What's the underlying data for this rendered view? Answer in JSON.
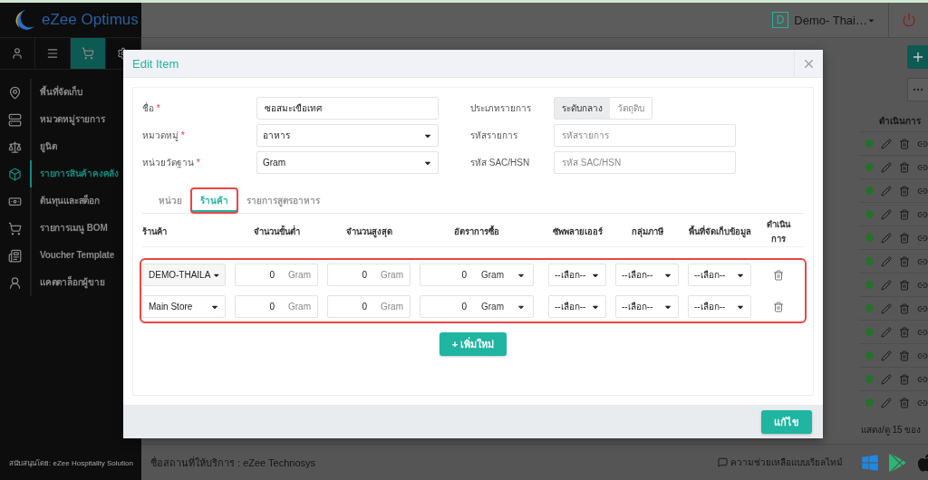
{
  "app": {
    "logo": "eZee Optimus",
    "property": {
      "badge": "D",
      "name": "Demo- Thai…"
    }
  },
  "sidebar": {
    "tabs": [
      {
        "selected": false
      },
      {
        "selected": false
      },
      {
        "selected": true
      },
      {
        "selected": false
      }
    ],
    "items": [
      {
        "label": "พื้นที่จัดเก็บ",
        "selected": false
      },
      {
        "label": "หมวดหมู่รายการ",
        "selected": false
      },
      {
        "label": "ยูนิต",
        "selected": false
      },
      {
        "label": "รายการสินค้าคงคลัง",
        "selected": true
      },
      {
        "label": "ต้นทุนและสต็อก",
        "selected": false
      },
      {
        "label": "รายการเมนู BOM",
        "selected": false
      },
      {
        "label": "Voucher Template",
        "selected": false
      },
      {
        "label": "แคตตาล็อกผู้ขาย",
        "selected": false
      }
    ],
    "footer": "สนับสนุนโดย: eZee Hospitality Solution"
  },
  "background_list": {
    "header": "ดำเนินการ",
    "rows": [
      {
        "color": "#26702c"
      },
      {
        "color": "#26702c"
      },
      {
        "color": "#26702c"
      },
      {
        "color": "#26702c"
      },
      {
        "color": "#26702c"
      },
      {
        "color": "#26702c"
      },
      {
        "color": "#26702c"
      },
      {
        "color": "#26702c"
      },
      {
        "color": "#26702c"
      },
      {
        "color": "#26702c"
      },
      {
        "color": "#26702c"
      },
      {
        "color": "#26702c"
      }
    ],
    "summary": "แสดง/ดู 15 ของ"
  },
  "footer": {
    "provider": "ชื่อสถานที่ให้บริการ : eZee Technosys",
    "help": "ความช่วยเหลือแบบเรียลไทม์"
  },
  "modal": {
    "title": "Edit Item",
    "fields_left": [
      {
        "label": "ชื่อ",
        "required_mark": "*",
        "kind": "text",
        "value": "ซอสมะเขือเทศ"
      },
      {
        "label": "หมวดหมู่",
        "required_mark": "*",
        "kind": "select",
        "value": "อาหาร"
      },
      {
        "label": "หน่วยวัดฐาน",
        "required_mark": "*",
        "kind": "select",
        "value": "Gram"
      }
    ],
    "fields_right": [
      {
        "label": "ประเภทรายการ",
        "kind": "toggle",
        "options": [
          {
            "label": "ระดับกลาง",
            "selected": true
          },
          {
            "label": "วัตถุดิบ",
            "selected": false
          }
        ]
      },
      {
        "label": "รหัสรายการ",
        "kind": "text",
        "placeholder": "รหัสรายการ"
      },
      {
        "label": "รหัส SAC/HSN",
        "kind": "text",
        "placeholder": "รหัส SAC/HSN"
      }
    ],
    "tabs": [
      {
        "label": "หน่วย",
        "selected": false,
        "highlighted": false
      },
      {
        "label": "ร้านค้า",
        "selected": true,
        "highlighted": true
      },
      {
        "label": "รายการสูตรอาหาร",
        "selected": false,
        "highlighted": false
      }
    ],
    "stores": {
      "highlighted": true,
      "columns": [
        "ร้านค้า",
        "จำนวนขั้นต่ำ",
        "จำนวนสูงสุด",
        "อัตราการซื้อ",
        "ซัพพลายเออร์",
        "กลุ่มภาษี",
        "พื้นที่จัดเก็บข้อมูล",
        "ดำเนินการ"
      ],
      "rows": [
        {
          "store": "DEMO-THAILA",
          "min": "0",
          "min_unit": "Gram",
          "max": "0",
          "max_unit": "Gram",
          "rate": "0",
          "rate_unit": "Gram",
          "supplier": "--เลือก--",
          "tax_group": "--เลือก--",
          "storage": "--เลือก--"
        },
        {
          "store": "Main Store",
          "min": "0",
          "min_unit": "Gram",
          "max": "0",
          "max_unit": "Gram",
          "rate": "0",
          "rate_unit": "Gram",
          "supplier": "--เลือก--",
          "tax_group": "--เลือก--",
          "storage": "--เลือก--"
        }
      ]
    },
    "add_button": "+ เพิ่มใหม่",
    "save_button": "แก้ไข"
  }
}
